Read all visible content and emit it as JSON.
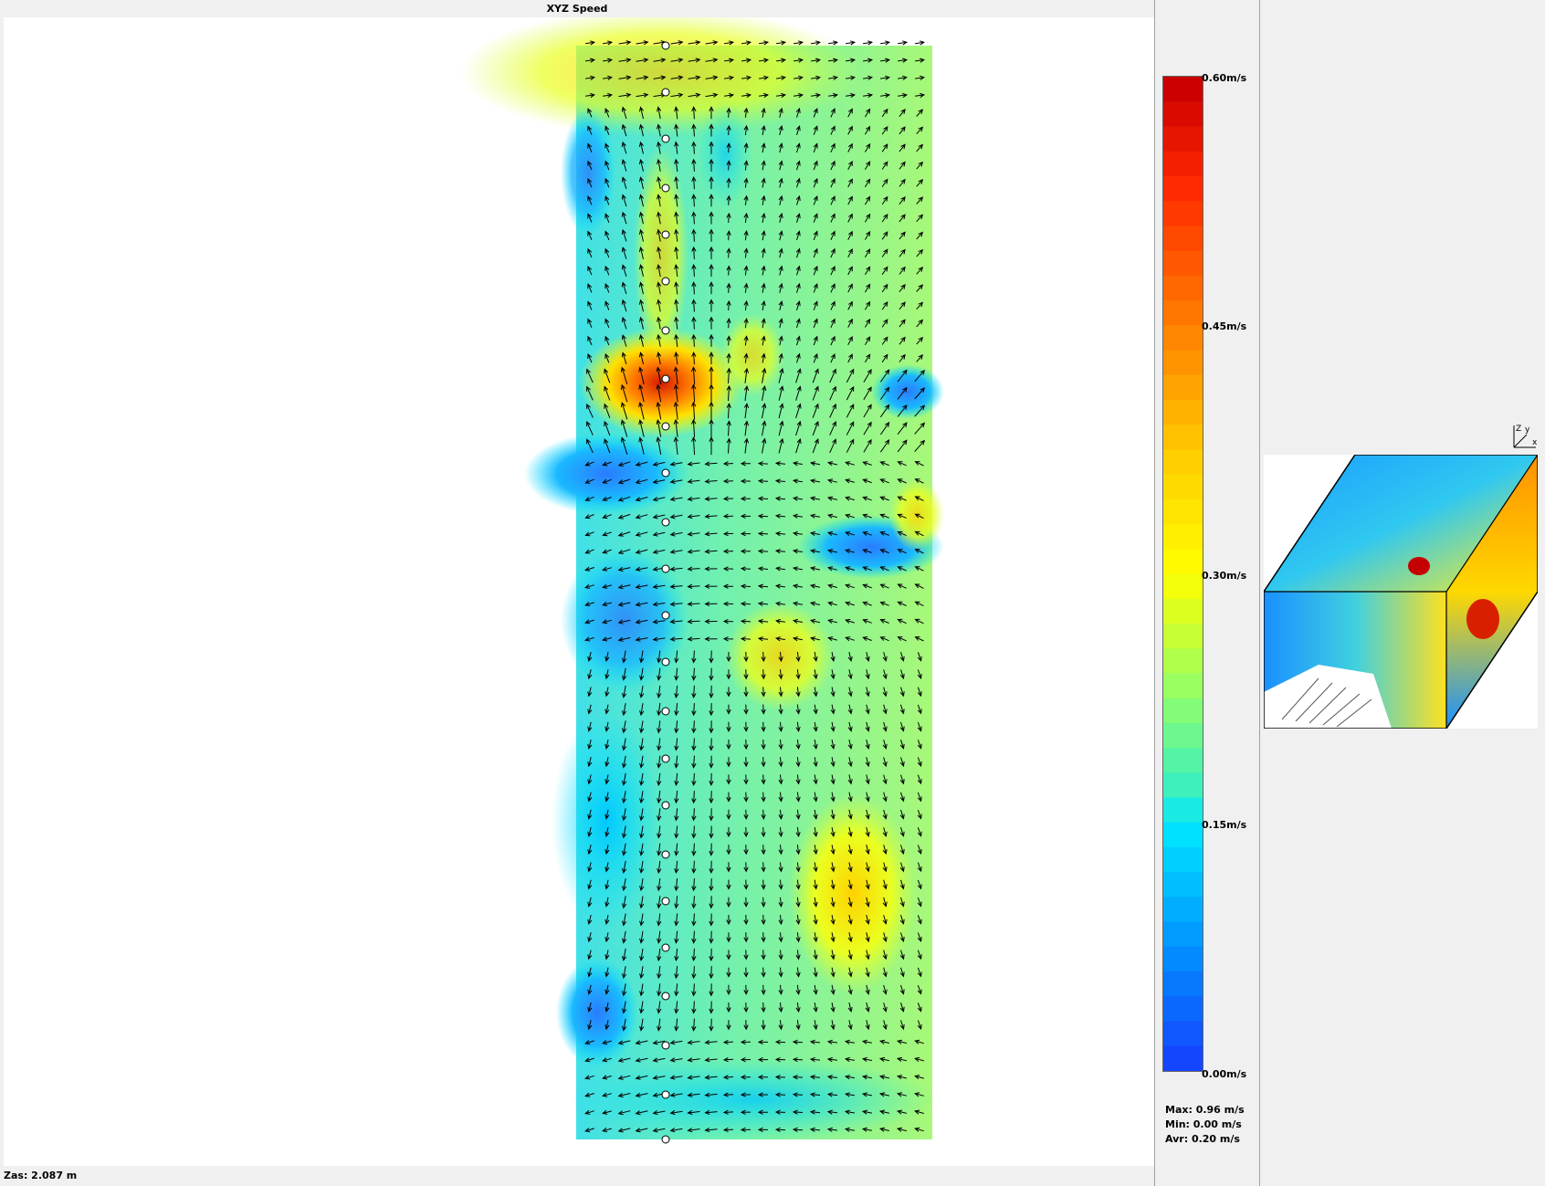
{
  "plot_title": "XYZ Speed",
  "status_text": "Zas: 2.087 m",
  "legend": {
    "labels": [
      "0.60m/s",
      "0.45m/s",
      "0.30m/s",
      "0.15m/s",
      "0.00m/s"
    ],
    "min_value": 0.0,
    "max_value": 0.6,
    "colors": [
      "#cc0000",
      "#ff3300",
      "#ff7f00",
      "#ffcc00",
      "#ffff00",
      "#99ff66",
      "#33ffcc",
      "#00e5ff",
      "#00aaff",
      "#0055ff"
    ]
  },
  "stats": {
    "max": "Max: 0.96 m/s",
    "min": "Min: 0.00 m/s",
    "avg": "Avr: 0.20 m/s"
  },
  "axes_labels": {
    "z": "Z",
    "y": "y",
    "x": "x"
  }
}
